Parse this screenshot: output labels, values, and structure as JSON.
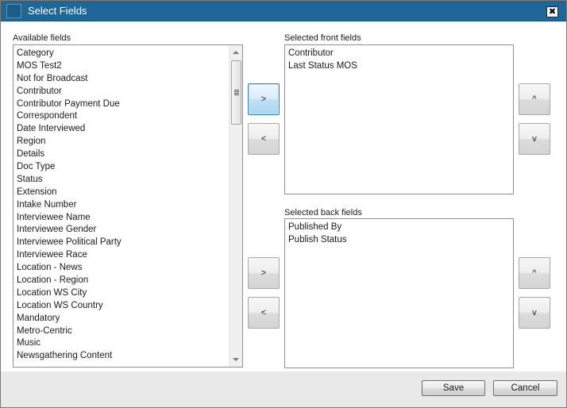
{
  "window": {
    "title": "Select Fields",
    "close_symbol": "✖"
  },
  "available": {
    "label": "Available fields",
    "items": [
      "Category",
      "MOS Test2",
      "Not for Broadcast",
      "Contributor",
      "Contributor Payment Due",
      "Correspondent",
      "Date Interviewed",
      "Region",
      "Details",
      "Doc Type",
      "Status",
      "Extension",
      "Intake Number",
      "Interviewee Name",
      "Interviewee Gender",
      "Interviewee Political Party",
      "Interviewee Race",
      "Location - News",
      "Location - Region",
      "Location WS City",
      "Location WS Country",
      "Mandatory",
      "Metro-Centric",
      "Music",
      "Newsgathering Content"
    ]
  },
  "front": {
    "label": "Selected front fields",
    "items": [
      "Contributor",
      "Last Status MOS"
    ],
    "add_label": ">",
    "remove_label": "<",
    "up_label": "^",
    "down_label": "v"
  },
  "back": {
    "label": "Selected back fields",
    "items": [
      "Published By",
      "Publish Status"
    ],
    "add_label": ">",
    "remove_label": "<",
    "up_label": "^",
    "down_label": "v"
  },
  "footer": {
    "save_label": "Save",
    "cancel_label": "Cancel"
  },
  "colors": {
    "titlebar": "#1f6796",
    "focus_accent": "#3c7fb1",
    "footer_bg": "#e9e9e9"
  }
}
